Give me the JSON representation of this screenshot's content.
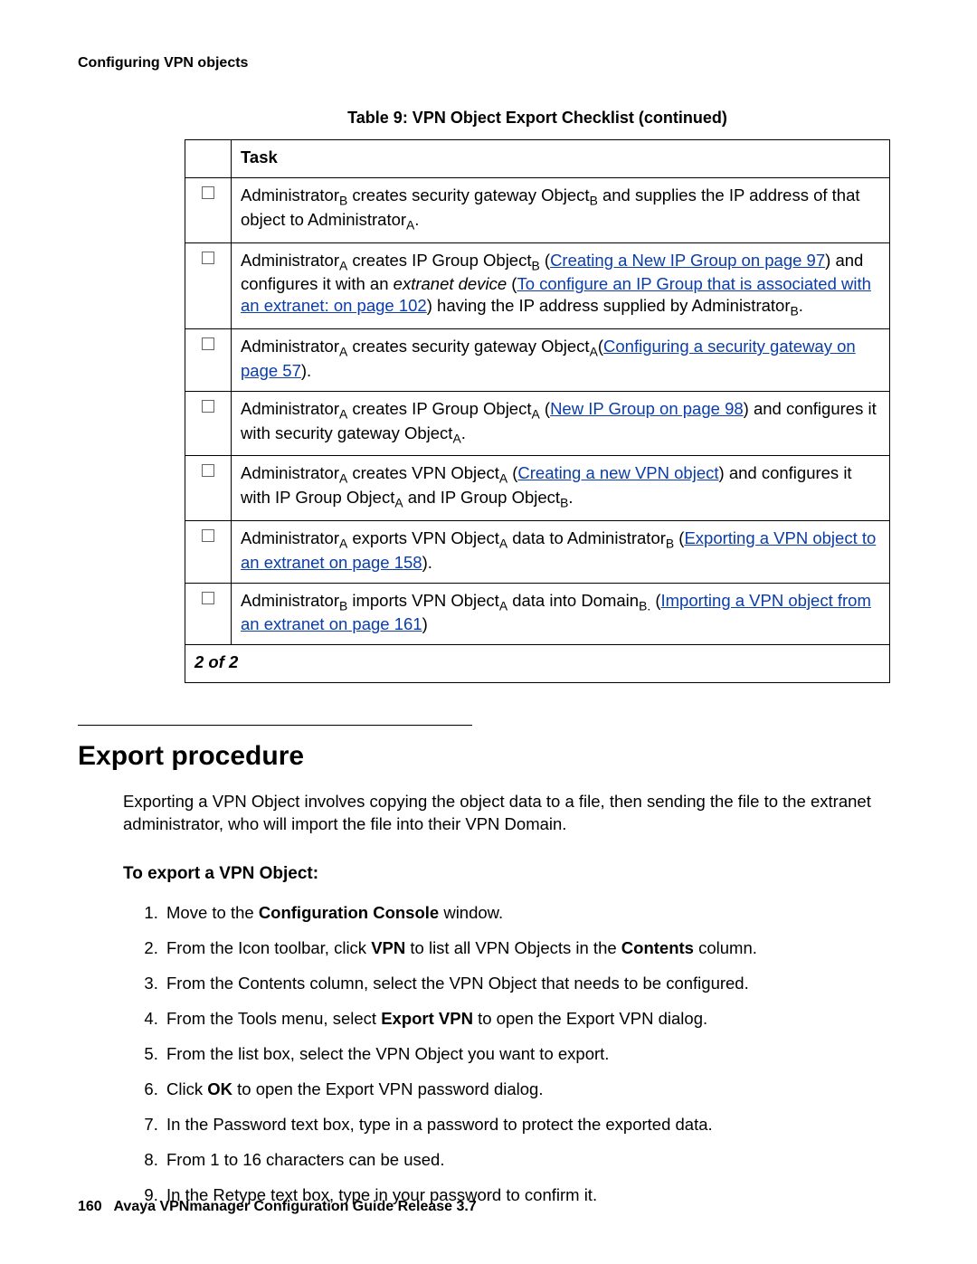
{
  "header": "Configuring VPN objects",
  "table": {
    "caption": "Table 9: VPN Object Export Checklist (continued)",
    "header": "Task",
    "pager": "2 of 2",
    "rows": [
      {
        "pre1": "Administrator",
        "sub1": "B",
        "post1": " creates security gateway Object",
        "sub2": "B",
        "post2": " and supplies the IP address of that object to Administrator",
        "sub3": "A",
        "post3": "."
      },
      {
        "pre1": "Administrator",
        "sub1": "A",
        "post1": " creates IP Group Object",
        "sub2": "B",
        "post2": " (",
        "link1": "Creating a New IP Group on page 97",
        "post3": ") and configures it with an ",
        "italic1": "extranet device",
        "post4": " (",
        "link2": "To configure an IP Group that is associated with an extranet: on page 102",
        "post5": ") having the IP address supplied by Administrator",
        "sub3": "B",
        "post6": "."
      },
      {
        "pre1": "Administrator",
        "sub1": "A",
        "post1": " creates security gateway Object",
        "sub2": "A",
        "post2": "(",
        "link1": "Configuring a security gateway on page 57",
        "post3": ")."
      },
      {
        "pre1": "Administrator",
        "sub1": "A",
        "post1": " creates IP Group Object",
        "sub2": "A",
        "post2": " (",
        "link1": "New IP Group on page 98",
        "post3": ") and configures it with security gateway Object",
        "sub3": "A",
        "post4": "."
      },
      {
        "pre1": "Administrator",
        "sub1": "A",
        "post1": " creates VPN Object",
        "sub2": "A",
        "post2": " (",
        "link1": "Creating a new VPN object",
        "post3": ") and configures it with IP Group Object",
        "sub3": "A",
        "post4": " and IP Group Object",
        "sub4": "B",
        "post5": "."
      },
      {
        "pre1": "Administrator",
        "sub1": "A",
        "post1": " exports VPN Object",
        "sub2": "A",
        "post2": " data to Administrator",
        "sub3": "B",
        "post3": " (",
        "link1": "Exporting a VPN object to an extranet on page 158",
        "post4": ")."
      },
      {
        "pre1": "Administrator",
        "sub1": "B",
        "post1": " imports VPN Object",
        "sub2": "A",
        "post2": " data into Domain",
        "sub3": "B.",
        "post3": " (",
        "link1": "Importing a VPN object from an extranet on page 161",
        "post4": ")"
      }
    ]
  },
  "section": {
    "title": "Export procedure",
    "intro": "Exporting a VPN Object involves copying the object data to a file, then sending the file to the extranet administrator, who will import the file into their VPN Domain.",
    "subheading": "To export a VPN Object:",
    "steps": [
      {
        "pre": "Move to the ",
        "b1": "Configuration Console",
        "post": " window."
      },
      {
        "pre": "From the Icon toolbar, click ",
        "b1": "VPN",
        "mid": " to list all VPN Objects in the ",
        "b2": "Contents",
        "post": " column."
      },
      {
        "pre": "From the Contents column, select the VPN Object that needs to be configured."
      },
      {
        "pre": "From the Tools menu, select ",
        "b1": "Export VPN",
        "post": " to open the Export VPN dialog."
      },
      {
        "pre": "From the list box, select the VPN Object you want to export."
      },
      {
        "pre": "Click ",
        "b1": "OK",
        "post": " to open the Export VPN password dialog."
      },
      {
        "pre": "In the Password text box, type in a password to protect the exported data."
      },
      {
        "pre": "From 1 to 16 characters can be used."
      },
      {
        "pre": "In the Retype text box, type in your password to confirm it."
      }
    ]
  },
  "footer": {
    "pagenum": "160",
    "title": "Avaya VPNmanager Configuration Guide Release 3.7"
  }
}
